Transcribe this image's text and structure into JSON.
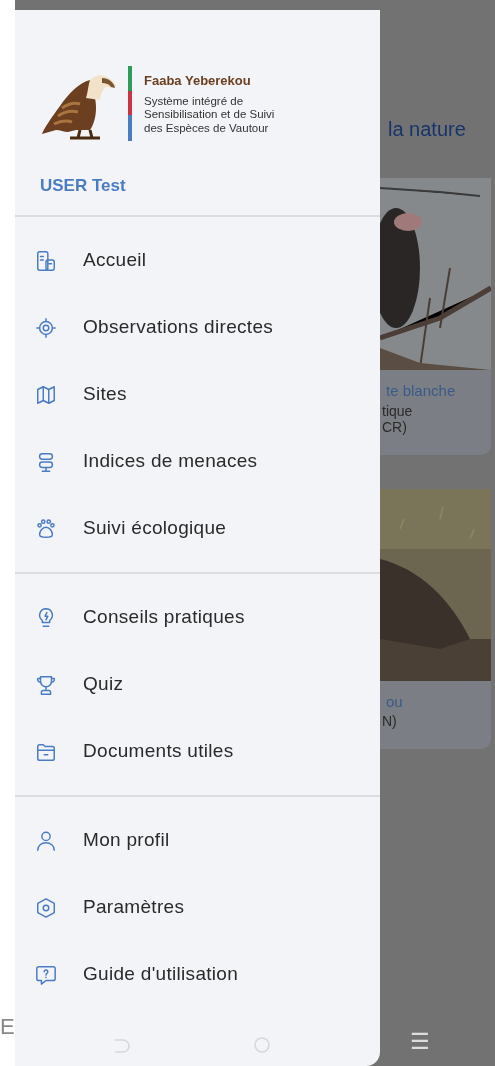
{
  "drawer": {
    "app_title": "Faaba Yeberekou",
    "subtitle_lines": [
      "Système intégré de",
      "Sensibilisation et de Suivi",
      "des Espèces de Vautour"
    ],
    "user": "USER Test",
    "menu_groups": [
      {
        "items": [
          {
            "label": "Accueil"
          },
          {
            "label": "Observations directes"
          },
          {
            "label": "Sites"
          },
          {
            "label": "Indices de menaces"
          },
          {
            "label": "Suivi écologique"
          }
        ]
      },
      {
        "items": [
          {
            "label": "Conseils pratiques"
          },
          {
            "label": "Quiz"
          },
          {
            "label": "Documents utiles"
          }
        ]
      },
      {
        "items": [
          {
            "label": "Mon profil"
          },
          {
            "label": "Paramètres"
          },
          {
            "label": "Guide d'utilisation"
          }
        ]
      }
    ]
  },
  "background_screen": {
    "heading": "la nature",
    "cards": [
      {
        "title": "te blanche",
        "lines": [
          "tique",
          "CR)"
        ]
      },
      {
        "title": "ou",
        "lines": [
          "N)"
        ]
      }
    ],
    "nav_glyph": "☰"
  },
  "side_text": "E"
}
